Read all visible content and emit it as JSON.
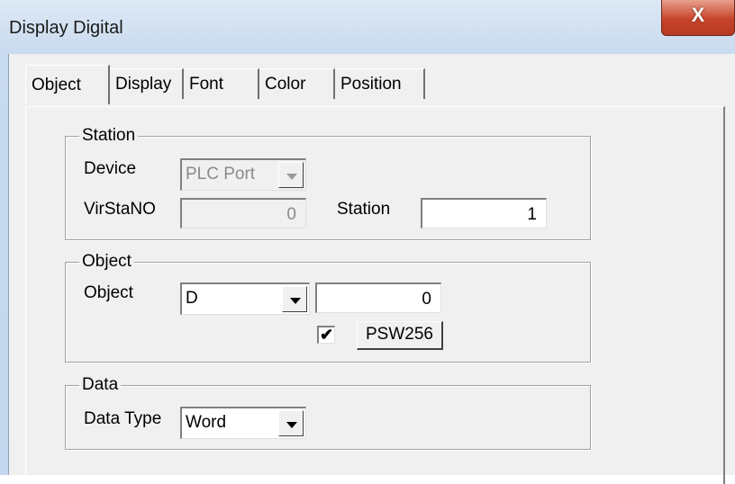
{
  "window": {
    "title": "Display Digital",
    "close_glyph": "X"
  },
  "tabs": [
    {
      "label": "Object",
      "active": true
    },
    {
      "label": "Display",
      "active": false
    },
    {
      "label": "Font",
      "active": false
    },
    {
      "label": "Color",
      "active": false
    },
    {
      "label": "Position",
      "active": false
    }
  ],
  "station": {
    "legend": "Station",
    "device_label": "Device",
    "device_value": "PLC Port",
    "virstano_label": "VirStaNO",
    "virstano_value": "0",
    "station_label": "Station",
    "station_value": "1"
  },
  "object": {
    "legend": "Object",
    "object_label": "Object",
    "object_type": "D",
    "object_address": "0",
    "psw_checked": true,
    "psw_check_glyph": "✔",
    "psw_button_label": "PSW256"
  },
  "data": {
    "legend": "Data",
    "type_label": "Data Type",
    "type_value": "Word"
  }
}
